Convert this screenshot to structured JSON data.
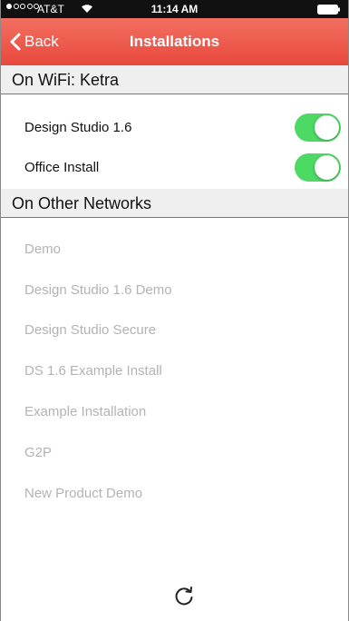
{
  "status_bar": {
    "carrier": "AT&T",
    "time": "11:14 AM",
    "signal_bars_filled": 1,
    "signal_bars_total": 5
  },
  "nav": {
    "back_label": "Back",
    "title": "Installations",
    "color": "#e8493c"
  },
  "wifi_section": {
    "header": "On WiFi: Ketra",
    "items": [
      {
        "label": "Design Studio 1.6",
        "enabled": true
      },
      {
        "label": "Office Install",
        "enabled": true
      }
    ]
  },
  "other_section": {
    "header": "On Other Networks",
    "items": [
      {
        "label": "Demo"
      },
      {
        "label": "Design Studio 1.6 Demo"
      },
      {
        "label": "Design Studio Secure"
      },
      {
        "label": "DS 1.6 Example Install"
      },
      {
        "label": "Example Installation"
      },
      {
        "label": "G2P"
      },
      {
        "label": "New Product Demo"
      }
    ]
  },
  "toolbar": {
    "refresh_icon": "refresh-icon"
  }
}
